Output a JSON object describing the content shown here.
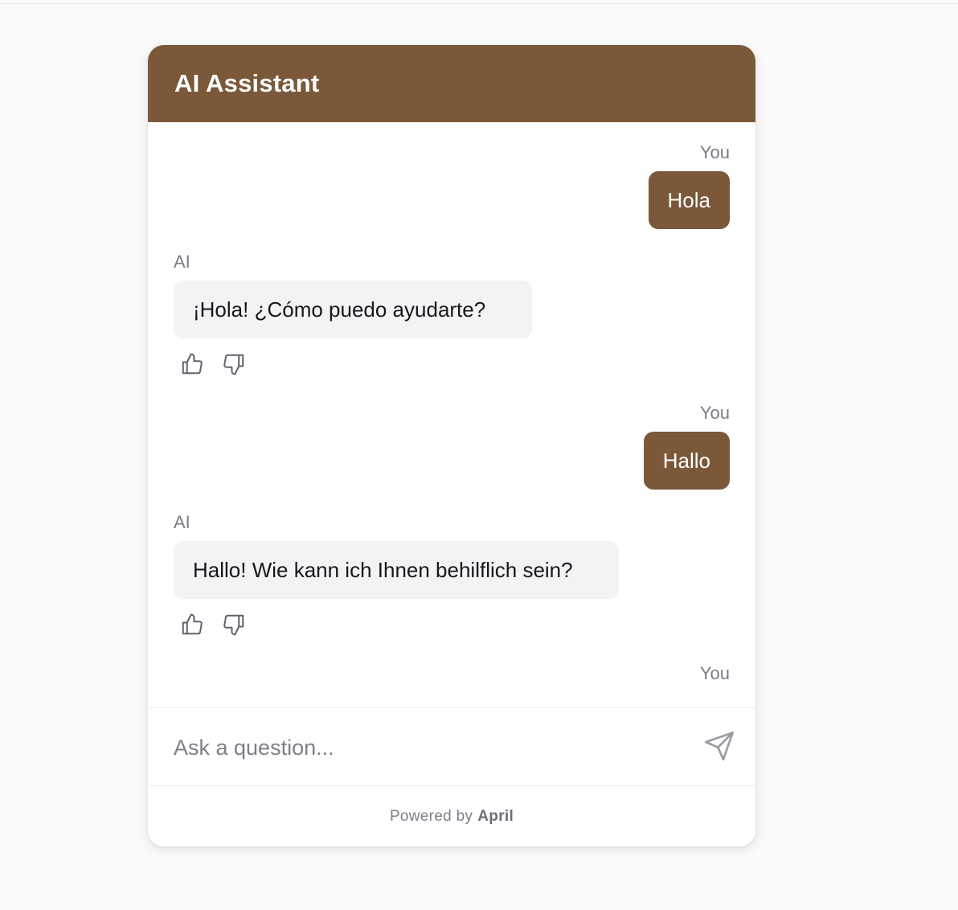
{
  "header": {
    "title": "AI Assistant",
    "background_color": "#7a5839"
  },
  "messages": [
    {
      "role": "user",
      "sender": "You",
      "text": "Hola"
    },
    {
      "role": "ai",
      "sender": "AI",
      "text": "¡Hola! ¿Cómo puedo ayudarte?"
    },
    {
      "role": "user",
      "sender": "You",
      "text": "Hallo"
    },
    {
      "role": "ai",
      "sender": "AI",
      "text": "Hallo! Wie kann ich Ihnen behilflich sein?"
    },
    {
      "role": "user",
      "sender": "You",
      "text": ""
    }
  ],
  "feedback": {
    "like_icon": "thumbs-up-icon",
    "dislike_icon": "thumbs-down-icon"
  },
  "input": {
    "placeholder": "Ask a question...",
    "value": "",
    "send_icon": "send-icon"
  },
  "footer": {
    "prefix": "Powered by",
    "brand": "April"
  },
  "colors": {
    "accent": "#7a5839",
    "ai_bubble": "#f2f3f5",
    "muted_text": "#7d8089"
  }
}
